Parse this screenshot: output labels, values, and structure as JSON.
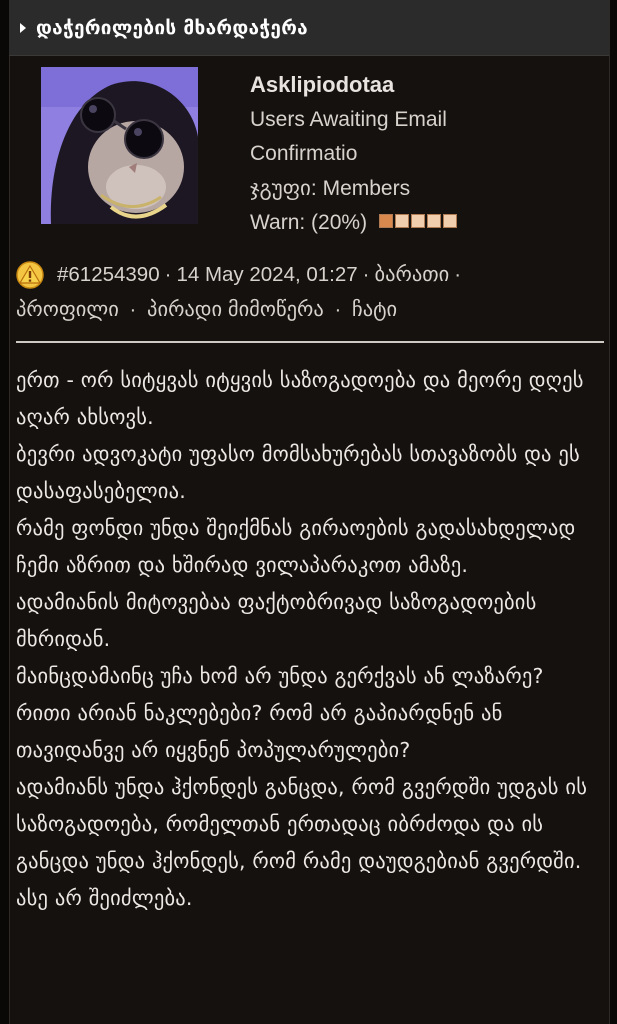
{
  "header": {
    "title": "დაჭერილების მხარდაჭერა"
  },
  "user": {
    "username": "Asklipiodotaa",
    "status_line1": "Users Awaiting Email",
    "status_line2": "Confirmatio",
    "group": "ჯგუფი: Members",
    "warn_label": "Warn: (20%)",
    "warn_level": 0.2
  },
  "post_meta": {
    "post_id": "#61254390",
    "date": "14 May 2024, 01:27",
    "link_barati": "ბარათი",
    "link_profile": "პროფილი",
    "link_pm": "პირადი მიმოწერა",
    "link_chat": "ჩატი",
    "separator": "·"
  },
  "post": {
    "paragraphs": [
      "ერთ - ორ სიტყვას იტყვის საზოგადოება და მეორე დღეს აღარ ახსოვს.",
      "ბევრი ადვოკატი უფასო მომსახურებას სთავაზობს და ეს დასაფასებელია.",
      "რამე ფონდი უნდა შეიქმნას გირაოების გადასახდელად ჩემი აზრით და ხშირად ვილაპარაკოთ ამაზე.",
      "ადამიანის მიტოვებაა ფაქტობრივად საზოგადოების მხრიდან.",
      "მაინცდამაინც უჩა ხომ არ უნდა გერქვას ან ლაზარე?",
      "რითი არიან ნაკლებები? რომ არ გაპიარდნენ ან თავიდანვე არ იყვნენ პოპულარულები?",
      "ადამიანს უნდა ჰქონდეს განცდა, რომ გვერდში უდგას ის საზოგადოება, რომელთან ერთადაც იბრძოდა და ის განცდა უნდა ჰქონდეს, რომ რამე დაუდგებიან გვერდში.",
      "ასე არ შეიძლება."
    ]
  },
  "colors": {
    "background": "#15110f",
    "header_bg": "#2c2b2b",
    "warn_on": "#d9894e",
    "warn_off": "#f1cfae",
    "avatar_bg": "#8f7fe0"
  },
  "icons": {
    "warning": "warning-triangle-icon",
    "caret": "caret-right-icon"
  }
}
